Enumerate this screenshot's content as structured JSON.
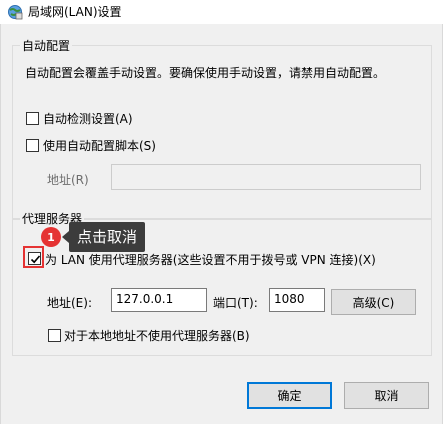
{
  "window": {
    "title": "局域网(LAN)设置",
    "icon": "network-settings-icon"
  },
  "auto_config": {
    "group_label": "自动配置",
    "description": "自动配置会覆盖手动设置。要确保使用手动设置，请禁用自动配置。",
    "auto_detect_label": "自动检测设置(A)",
    "auto_detect_checked": false,
    "use_script_label": "使用自动配置脚本(S)",
    "use_script_checked": false,
    "address_label": "地址(R)",
    "address_value": ""
  },
  "proxy": {
    "group_label": "代理服务器",
    "use_proxy_label": "为 LAN 使用代理服务器(这些设置不用于拨号或 VPN 连接)(X)",
    "use_proxy_checked": true,
    "address_label": "地址(E):",
    "address_value": "127.0.0.1",
    "port_label": "端口(T):",
    "port_value": "1080",
    "advanced_label": "高级(C)",
    "bypass_local_label": "对于本地地址不使用代理服务器(B)",
    "bypass_local_checked": false
  },
  "annotation": {
    "badge_number": "1",
    "tooltip_text": "点击取消",
    "color": "#e53333"
  },
  "buttons": {
    "ok_label": "确定",
    "cancel_label": "取消"
  }
}
